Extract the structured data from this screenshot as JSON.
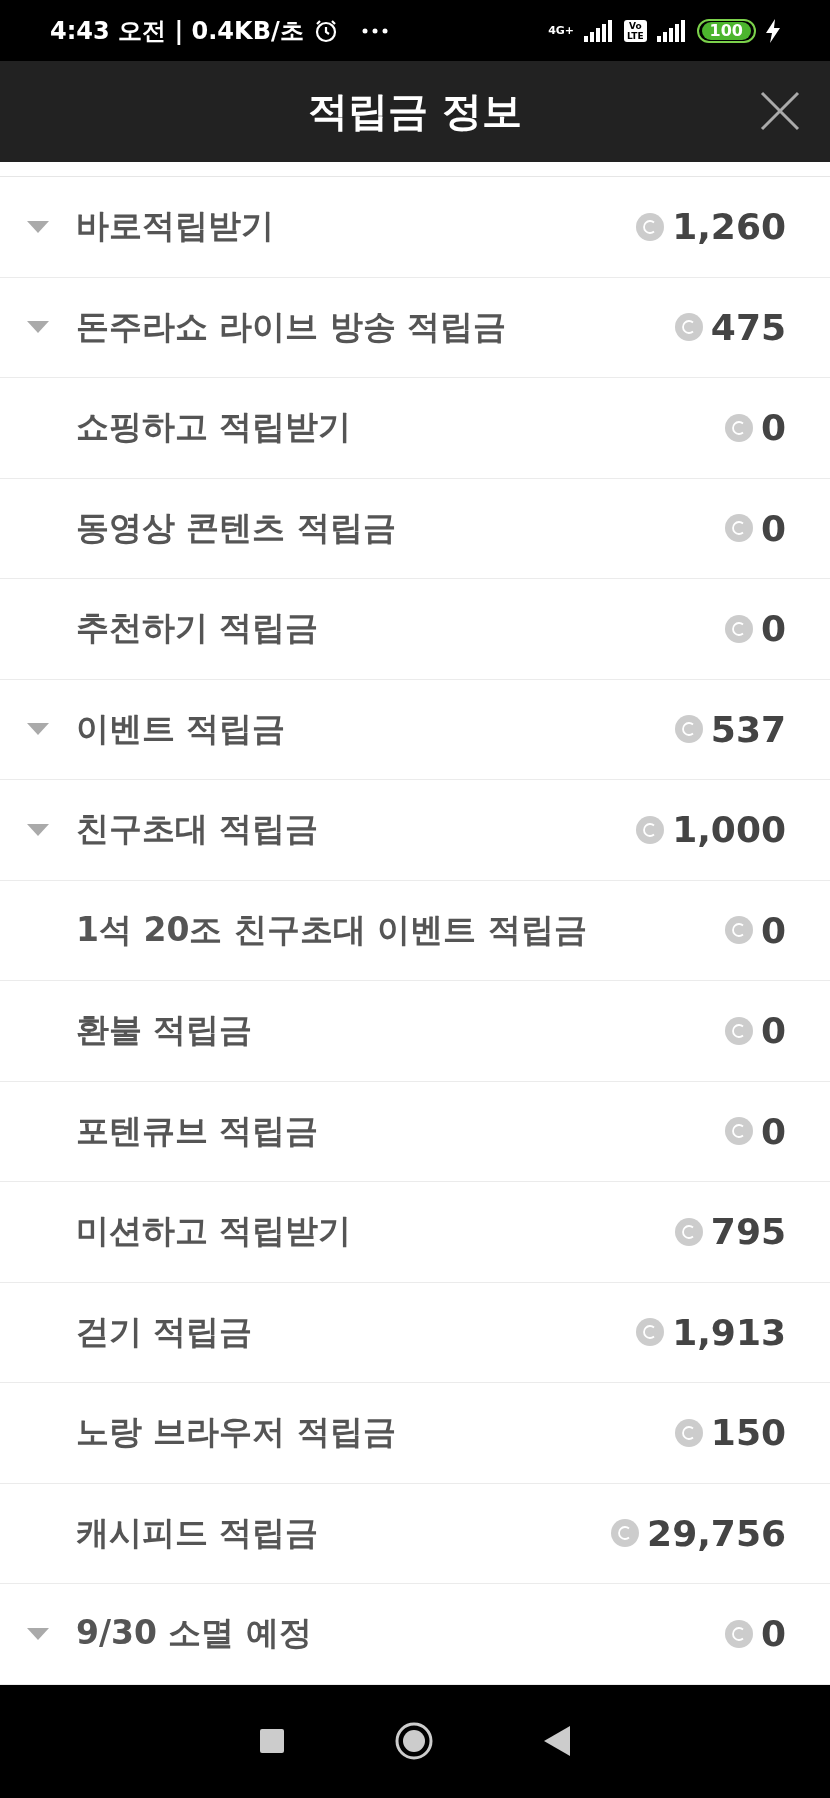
{
  "status_bar": {
    "time": "4:43 오전 | 0.4KB/초",
    "network": "4G+",
    "volte": [
      "Vo",
      "LTE"
    ],
    "battery": "100"
  },
  "header": {
    "title": "적립금 정보"
  },
  "rows": [
    {
      "label": "바로적립받기",
      "amount": "1,260",
      "kind": "group"
    },
    {
      "label": "돈주라쇼 라이브 방송 적립금",
      "amount": "475",
      "kind": "group"
    },
    {
      "label": "쇼핑하고 적립받기",
      "amount": "0",
      "kind": "item"
    },
    {
      "label": "동영상 콘텐츠 적립금",
      "amount": "0",
      "kind": "item"
    },
    {
      "label": "추천하기 적립금",
      "amount": "0",
      "kind": "item"
    },
    {
      "label": "이벤트 적립금",
      "amount": "537",
      "kind": "group"
    },
    {
      "label": "친구초대 적립금",
      "amount": "1,000",
      "kind": "group"
    },
    {
      "label": "1석 20조 친구초대 이벤트 적립금",
      "amount": "0",
      "kind": "item"
    },
    {
      "label": "환불 적립금",
      "amount": "0",
      "kind": "item"
    },
    {
      "label": "포텐큐브 적립금",
      "amount": "0",
      "kind": "item"
    },
    {
      "label": "미션하고 적립받기",
      "amount": "795",
      "kind": "item"
    },
    {
      "label": "걷기 적립금",
      "amount": "1,913",
      "kind": "item"
    },
    {
      "label": "노랑 브라우저 적립금",
      "amount": "150",
      "kind": "item"
    },
    {
      "label": "캐시피드 적립금",
      "amount": "29,756",
      "kind": "item"
    },
    {
      "label": "9/30 소멸 예정",
      "amount": "0",
      "kind": "group"
    }
  ]
}
